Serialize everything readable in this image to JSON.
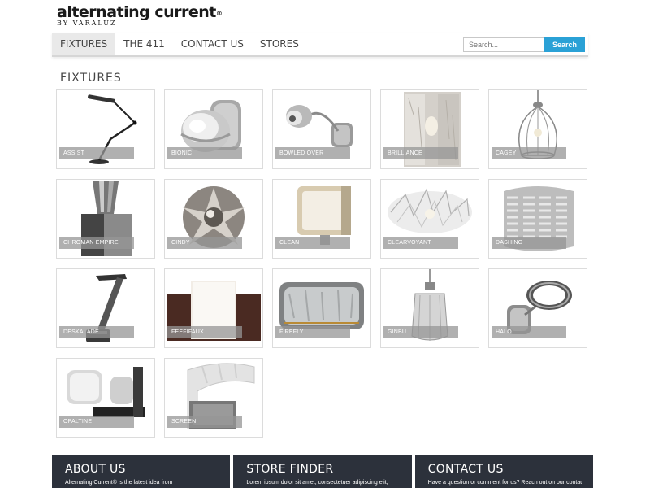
{
  "brand": {
    "name": "alternating current",
    "registered": "®",
    "tagline": "BY VARALUZ"
  },
  "nav": {
    "items": [
      {
        "label": "FIXTURES",
        "active": true
      },
      {
        "label": "THE 411",
        "active": false
      },
      {
        "label": "CONTACT US",
        "active": false
      },
      {
        "label": "STORES",
        "active": false
      }
    ]
  },
  "search": {
    "placeholder": "Search...",
    "button_label": "Search"
  },
  "section": {
    "title": "FIXTURES"
  },
  "products": [
    {
      "label": "ASSIST",
      "icon": "desk-lamp"
    },
    {
      "label": "BIONIC",
      "icon": "sconce-globe"
    },
    {
      "label": "BOWLED OVER",
      "icon": "sconce-arm"
    },
    {
      "label": "BRILLIANCE",
      "icon": "glass-panel"
    },
    {
      "label": "CAGEY",
      "icon": "cage-pendant"
    },
    {
      "label": "CHROMAN EMPIRE",
      "icon": "table-lamp"
    },
    {
      "label": "CINDY",
      "icon": "chrome-cluster"
    },
    {
      "label": "CLEAN",
      "icon": "square-sconce"
    },
    {
      "label": "CLEARVOYANT",
      "icon": "crystal-flush"
    },
    {
      "label": "DASHING",
      "icon": "striped-shade"
    },
    {
      "label": "DESKALADE",
      "icon": "led-desk-lamp"
    },
    {
      "label": "FEEFIFAUX",
      "icon": "wood-panel-sconce"
    },
    {
      "label": "FIREFLY",
      "icon": "drum-vanity"
    },
    {
      "label": "GINBU",
      "icon": "glass-pendant"
    },
    {
      "label": "HALO",
      "icon": "ring-sconce"
    },
    {
      "label": "OPALTINE",
      "icon": "bath-bar"
    },
    {
      "label": "SCREEN",
      "icon": "curved-screen-sconce"
    }
  ],
  "footer": {
    "columns": [
      {
        "title": "ABOUT US",
        "text": "Alternating Current® is the latest idea from"
      },
      {
        "title": "STORE FINDER",
        "text": "Lorem ipsum dolor sit amet, consectetuer adipiscing elit,"
      },
      {
        "title": "CONTACT US",
        "text": "Have a question or comment for us? Reach out on our contact"
      }
    ]
  },
  "colors": {
    "accent": "#2aa1d6",
    "footer_bg": "#2c313b",
    "label_bg": "#969696"
  }
}
